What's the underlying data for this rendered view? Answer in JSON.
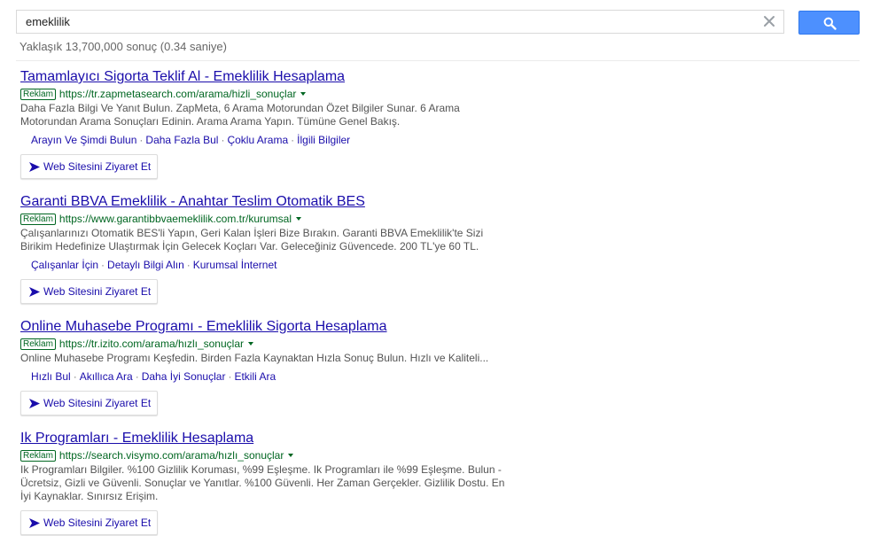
{
  "search": {
    "query": "emeklilik",
    "stats": "Yaklaşık 13,700,000 sonuç (0.34 saniye)"
  },
  "colors": {
    "link": "#1a0dab",
    "url_green": "#006621",
    "button_blue": "#4d90fe"
  },
  "icons": {
    "clear": "close-icon",
    "search": "search-icon",
    "visit": "arrow-right-icon"
  },
  "ads": [
    {
      "title": "Tamamlayıcı Sigorta Teklif Al - Emeklilik Hesaplama",
      "badge": "Reklam",
      "url": "https://tr.zapmetasearch.com/arama/hizli_sonuçlar",
      "desc_lines": [
        "Daha Fazla Bilgi Ve Yanıt Bulun. ZapMeta, 6 Arama Motorundan Özet Bilgiler Sunar. 6 Arama",
        "Motorundan Arama Sonuçları Edinin. Arama Arama Yapın. Tümüne Genel Bakış."
      ],
      "sitelinks": [
        "Arayın Ve Şimdi Bulun",
        "Daha Fazla Bul",
        "Çoklu Arama",
        "İlgili Bilgiler"
      ],
      "visit": "Web Sitesini Ziyaret Et"
    },
    {
      "title": "Garanti BBVA Emeklilik - Anahtar Teslim Otomatik BES",
      "badge": "Reklam",
      "url": "https://www.garantibbvaemeklilik.com.tr/kurumsal",
      "desc_lines": [
        "Çalışanlarınızı Otomatik BES'li Yapın, Geri Kalan İşleri Bize Bırakın. Garanti BBVA Emeklilik'te Sizi",
        "Birikim Hedefinize Ulaştırmak İçin Gelecek Koçları Var. Geleceğiniz Güvencede. 200 TL'ye 60 TL."
      ],
      "sitelinks": [
        "Çalışanlar İçin",
        "Detaylı Bilgi Alın",
        "Kurumsal İnternet"
      ],
      "visit": "Web Sitesini Ziyaret Et"
    },
    {
      "title": "Online Muhasebe Programı - Emeklilik Sigorta Hesaplama",
      "badge": "Reklam",
      "url": "https://tr.izito.com/arama/hızlı_sonuçlar",
      "desc_lines": [
        "Online Muhasebe Programı Keşfedin. Birden Fazla Kaynaktan Hızla Sonuç Bulun. Hızlı ve Kaliteli..."
      ],
      "sitelinks": [
        "Hızlı Bul",
        "Akıllıca Ara",
        "Daha İyi Sonuçlar",
        "Etkili Ara"
      ],
      "visit": "Web Sitesini Ziyaret Et"
    },
    {
      "title": "Ik Programları - Emeklilik Hesaplama",
      "badge": "Reklam",
      "url": "https://search.visymo.com/arama/hızlı_sonuçlar",
      "desc_lines": [
        "Ik Programları Bilgiler. %100 Gizlilik Koruması, %99 Eşleşme. Ik Programları ile %99 Eşleşme. Bulun -",
        "Ücretsiz, Gizli ve Güvenli. Sonuçlar ve Yanıtlar. %100 Güvenli. Her Zaman Gerçekler. Gizlilik Dostu. En",
        "İyi Kaynaklar. Sınırsız Erişim."
      ],
      "sitelinks": [],
      "visit": "Web Sitesini Ziyaret Et"
    }
  ]
}
